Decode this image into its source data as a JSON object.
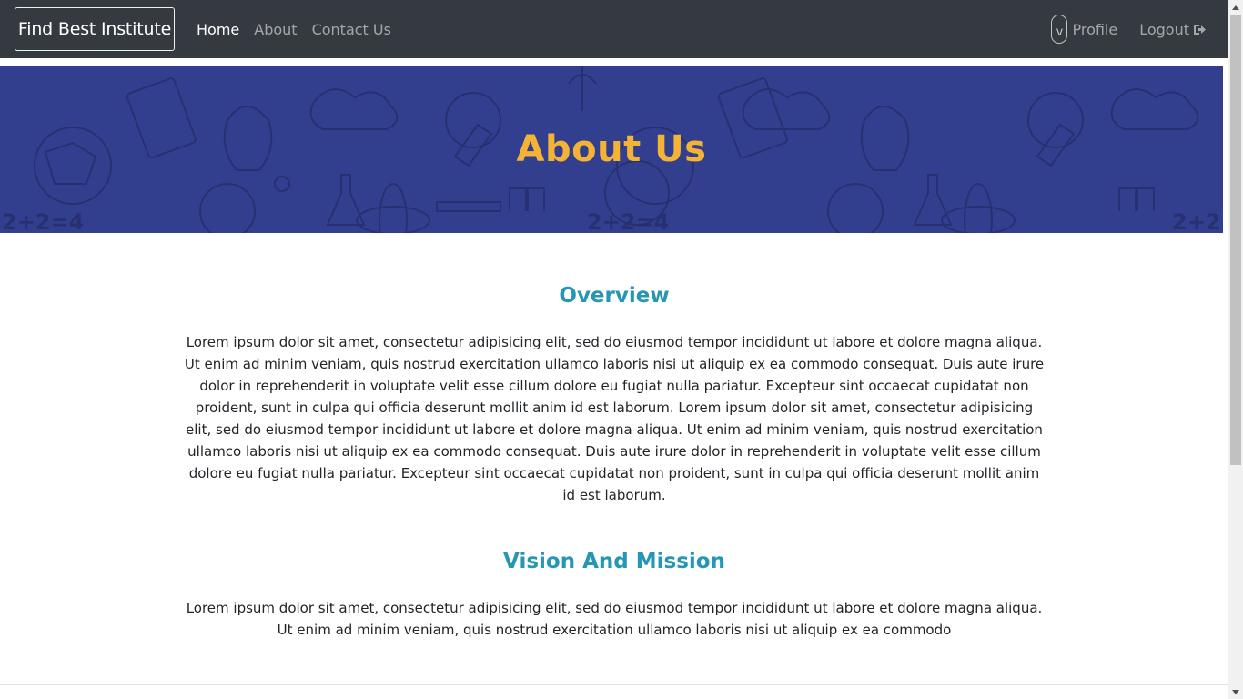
{
  "navbar": {
    "brand": "Find Best Institute",
    "links": [
      {
        "label": "Home",
        "active": true
      },
      {
        "label": "About",
        "active": false
      },
      {
        "label": "Contact Us",
        "active": false
      }
    ],
    "avatar_letter": "v",
    "profile_label": "Profile",
    "logout_label": "Logout",
    "logout_icon": "sign-out-icon"
  },
  "hero": {
    "title": "About Us",
    "background_color": "#323f8f",
    "title_color": "#f5b335"
  },
  "overview": {
    "title": "Overview",
    "text": "Lorem ipsum dolor sit amet, consectetur adipisicing elit, sed do eiusmod tempor incididunt ut labore et dolore magna aliqua. Ut enim ad minim veniam, quis nostrud exercitation ullamco laboris nisi ut aliquip ex ea commodo consequat. Duis aute irure dolor in reprehenderit in voluptate velit esse cillum dolore eu fugiat nulla pariatur. Excepteur sint occaecat cupidatat non proident, sunt in culpa qui officia deserunt mollit anim id est laborum. Lorem ipsum dolor sit amet, consectetur adipisicing elit, sed do eiusmod tempor incididunt ut labore et dolore magna aliqua. Ut enim ad minim veniam, quis nostrud exercitation ullamco laboris nisi ut aliquip ex ea commodo consequat. Duis aute irure dolor in reprehenderit in voluptate velit esse cillum dolore eu fugiat nulla pariatur. Excepteur sint occaecat cupidatat non proident, sunt in culpa qui officia deserunt mollit anim id est laborum."
  },
  "vision": {
    "title": "Vision And Mission",
    "text": "Lorem ipsum dolor sit amet, consectetur adipisicing elit, sed do eiusmod tempor incididunt ut labore et dolore magna aliqua. Ut enim ad minim veniam, quis nostrud exercitation ullamco laboris nisi ut aliquip ex ea commodo"
  },
  "colors": {
    "navbar": "#343a40",
    "section_title": "#2596b3"
  }
}
